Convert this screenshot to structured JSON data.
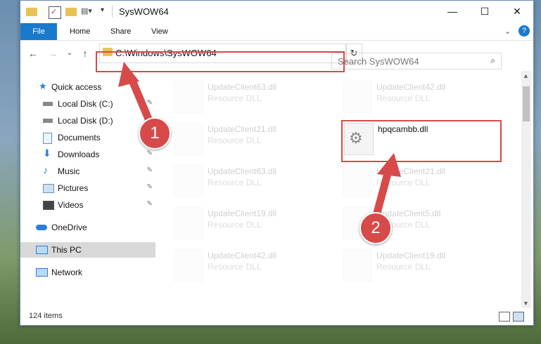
{
  "window": {
    "title": "SysWOW64",
    "minimize": "—",
    "maximize": "☐",
    "close": "✕"
  },
  "ribbon": {
    "file": "File",
    "home": "Home",
    "share": "Share",
    "view": "View",
    "collapse": "⌄",
    "help": "?"
  },
  "address": {
    "path": "C:\\Windows\\SysWOW64",
    "dropdown": "⌄",
    "refresh": "↻"
  },
  "nav": {
    "back": "←",
    "forward": "→",
    "recent": "⌄",
    "up": "↑"
  },
  "search": {
    "placeholder": "Search SysWOW64",
    "icon": "⌕"
  },
  "sidebar": {
    "items": [
      {
        "label": "Quick access"
      },
      {
        "label": "Local Disk (C:)"
      },
      {
        "label": "Local Disk (D:)"
      },
      {
        "label": "Documents"
      },
      {
        "label": "Downloads"
      },
      {
        "label": "Music"
      },
      {
        "label": "Pictures"
      },
      {
        "label": "Videos"
      },
      {
        "label": "OneDrive"
      },
      {
        "label": "This PC"
      },
      {
        "label": "Network"
      }
    ],
    "pin": "✎"
  },
  "files": [
    {
      "name": "UpdateClient63.dll",
      "type": "Resource DLL"
    },
    {
      "name": "UpdateClient42.dll",
      "type": "Resource DLL"
    },
    {
      "name": "UpdateClient21.dll",
      "type": "Resource DLL"
    },
    {
      "name": "hpqcambb.dll",
      "type": ""
    },
    {
      "name": "UpdateClient63.dll",
      "type": "Resource DLL"
    },
    {
      "name": "UpdateClient21.dll",
      "type": "Resource DLL"
    },
    {
      "name": "UpdateClient19.dll",
      "type": "Resource DLL"
    },
    {
      "name": "UpdateClient5.dll",
      "type": "Resource DLL"
    },
    {
      "name": "UpdateClient42.dll",
      "type": "Resource DLL"
    },
    {
      "name": "UpdateClient19.dll",
      "type": "Resource DLL"
    }
  ],
  "status": {
    "count": "124 items"
  },
  "annotations": {
    "step1": "1",
    "step2": "2"
  },
  "colors": {
    "accent": "#1979ca",
    "annotation": "#d64a4a"
  }
}
